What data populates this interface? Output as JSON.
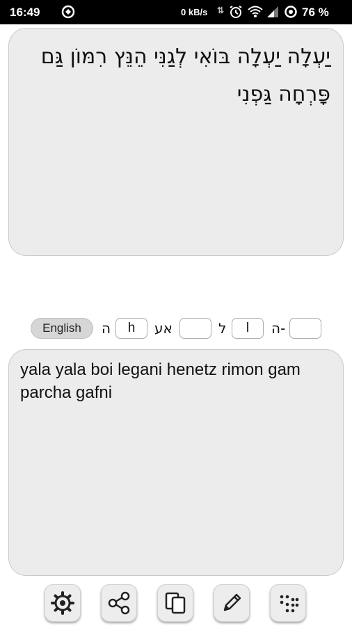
{
  "status_bar": {
    "time": "16:49",
    "speed": "0 kB/s",
    "battery": "76 %",
    "icons": [
      "app-notification-icon",
      "data-arrows-icon",
      "alarm-icon",
      "wifi-icon",
      "signal-icon",
      "battery-saver-icon"
    ]
  },
  "hebrew_text": "יַעְלָה יַעְלָה בּוֹאִי לְגַנִּי הֵנֵּץ רִמּוֹן גַּם פָּרְחָה גַּפְנִי",
  "transliteration_text": "yala yala boi legani henetz rimon gam parcha gafni",
  "mapping_row": {
    "language_button": "English",
    "mappings": [
      {
        "hebrew": "ה",
        "value": "h"
      },
      {
        "hebrew": "אע",
        "value": ""
      },
      {
        "hebrew": "ל",
        "value": "l"
      },
      {
        "hebrew": "ה-",
        "value": ""
      }
    ]
  },
  "toolbar": {
    "buttons": [
      "settings-icon",
      "share-icon",
      "copy-icon",
      "edit-icon",
      "braille-dots-icon"
    ]
  },
  "colors": {
    "status_bar": "#000000",
    "panel_background": "#ececec",
    "button_background": "#ededed"
  }
}
